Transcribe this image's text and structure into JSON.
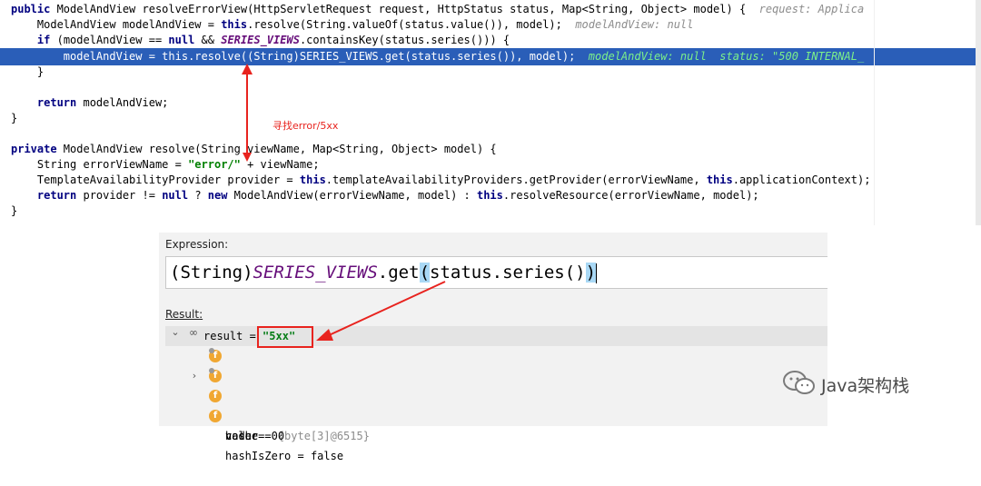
{
  "editor": {
    "lines": [
      {
        "code_parts": [
          [
            "k",
            "public "
          ],
          [
            "",
            "ModelAndView resolveErrorView(HttpServletRequest request, HttpStatus status, Map<String, Object> model) {  "
          ],
          [
            "hint",
            "request: Applica"
          ]
        ]
      },
      {
        "code_parts": [
          [
            "",
            "    ModelAndView modelAndView = "
          ],
          [
            "k",
            "this"
          ],
          [
            "",
            ".resolve(String.valueOf(status.value()), model);  "
          ],
          [
            "hint",
            "modelAndView: null"
          ]
        ]
      },
      {
        "code_parts": [
          [
            "",
            "    "
          ],
          [
            "k",
            "if "
          ],
          [
            "",
            "(modelAndView == "
          ],
          [
            "k",
            "null "
          ],
          [
            "",
            "&& "
          ],
          [
            "f",
            "SERIES_VIEWS"
          ],
          [
            "",
            ".containsKey(status.series())) {"
          ]
        ]
      },
      {
        "code_parts": [
          [
            "",
            "        modelAndView = this.resolve((String)SERIES_VIEWS.get(status.series()), model);  "
          ],
          [
            "hl-hint",
            "modelAndView: null  status: \"500 INTERNAL_"
          ]
        ]
      },
      {
        "code_parts": [
          [
            "",
            "    }"
          ]
        ]
      },
      {
        "code_parts": [
          [
            "",
            ""
          ]
        ]
      },
      {
        "code_parts": [
          [
            "",
            "    "
          ],
          [
            "k",
            "return "
          ],
          [
            "",
            "modelAndView;"
          ]
        ]
      },
      {
        "code_parts": [
          [
            "",
            "}"
          ]
        ]
      },
      {
        "code_parts": [
          [
            "",
            ""
          ]
        ]
      },
      {
        "code_parts": [
          [
            "k",
            "private "
          ],
          [
            "",
            "ModelAndView resolve(String viewName, Map<String, Object> model) {"
          ]
        ]
      },
      {
        "code_parts": [
          [
            "",
            "    String errorViewName = "
          ],
          [
            "s",
            "\"error/\""
          ],
          [
            "",
            " + viewName;"
          ]
        ]
      },
      {
        "code_parts": [
          [
            "",
            "    TemplateAvailabilityProvider provider = "
          ],
          [
            "k",
            "this"
          ],
          [
            "",
            ".templateAvailabilityProviders.getProvider(errorViewName, "
          ],
          [
            "k",
            "this"
          ],
          [
            "",
            ".applicationContext);"
          ]
        ]
      },
      {
        "code_parts": [
          [
            "",
            "    "
          ],
          [
            "k",
            "return "
          ],
          [
            "",
            "provider != "
          ],
          [
            "k",
            "null "
          ],
          [
            "",
            "? "
          ],
          [
            "k",
            "new "
          ],
          [
            "",
            "ModelAndView(errorViewName, model) : "
          ],
          [
            "k",
            "this"
          ],
          [
            "",
            ".resolveResource(errorViewName, model);"
          ]
        ]
      },
      {
        "code_parts": [
          [
            "",
            "}"
          ]
        ]
      }
    ],
    "annotation": "寻找error/5xx"
  },
  "evaluate": {
    "expression_label": "Expression:",
    "expression_prefix": "(String)",
    "expression_field": "SERIES_VIEWS",
    "expression_mid": ".get",
    "expression_open": "(",
    "expression_inner": "status.series()",
    "expression_close": ")",
    "result_label": "Result:",
    "result": {
      "name": "result",
      "eq": " = ",
      "value": "\"5xx\""
    },
    "children": [
      {
        "name": "value",
        "eq": " = ",
        "value": "{byte[3]@6515}",
        "expandable": true
      },
      {
        "name": "coder",
        "eq": " = ",
        "value": "0",
        "expandable": false
      },
      {
        "name": "hash",
        "eq": " = ",
        "value": "0",
        "expandable": false
      },
      {
        "name": "hashIsZero",
        "eq": " = ",
        "value": "false",
        "expandable": false
      }
    ]
  },
  "watermark": {
    "text": "Java架构栈"
  },
  "colors": {
    "highlight": "#2a5eb8",
    "annotation": "#e8231e",
    "string_green": "#067d17",
    "badge": "#f0a732"
  }
}
